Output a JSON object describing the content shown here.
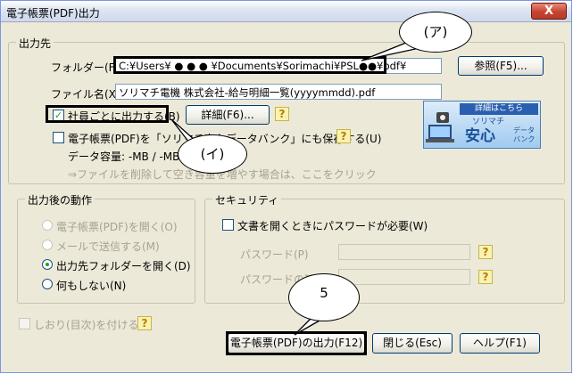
{
  "window": {
    "title": "電子帳票(PDF)出力",
    "close": "X"
  },
  "output_dest": {
    "group_label": "出力先",
    "folder_label": "フォルダー(F)",
    "folder_value": "C:¥Users¥ ● ● ● ¥Documents¥Sorimachi¥PSL●●¥pdf¥",
    "browse_button": "参照(F5)...",
    "filename_label": "ファイル名(X)",
    "filename_value": "ソリマチ電機 株式会社-給与明細一覧(yyyymmdd).pdf",
    "per_employee_label": "社員ごとに出力する(B)",
    "per_employee_checked": true,
    "details_button": "詳細(F6)...",
    "help": "?",
    "databank_label": "電子帳票(PDF)を「ソリマチ安心データバンク」にも保存する(U)",
    "databank_checked": false,
    "data_capacity": "データ容量: -MB / -MB",
    "data_hint": "⇒ファイルを削除して空き容量を増やす場合は、ここをクリック"
  },
  "banner": {
    "top": "詳細はこちら",
    "sub": "ソリマチ",
    "big": "安心",
    "small1": "データ",
    "small2": "バンク"
  },
  "after_output": {
    "group_label": "出力後の動作",
    "options": [
      {
        "label": "電子帳票(PDF)を開く(O)",
        "enabled": false,
        "selected": false
      },
      {
        "label": "メールで送信する(M)",
        "enabled": false,
        "selected": false
      },
      {
        "label": "出力先フォルダーを開く(D)",
        "enabled": true,
        "selected": true
      },
      {
        "label": "何もしない(N)",
        "enabled": true,
        "selected": false
      }
    ]
  },
  "security": {
    "group_label": "セキュリティ",
    "password_required_label": "文書を開くときにパスワードが必要(W)",
    "password_label": "パスワード(P)",
    "password_confirm_label": "パスワードの確認(C)"
  },
  "bookmark_label": "しおり(目次)を付ける(I)",
  "footer": {
    "output_button": "電子帳票(PDF)の出力(F12)",
    "close_button": "閉じる(Esc)",
    "help_button": "ヘルプ(F1)"
  },
  "callouts": {
    "a": "(ア)",
    "i": "(イ)",
    "five": "5"
  }
}
